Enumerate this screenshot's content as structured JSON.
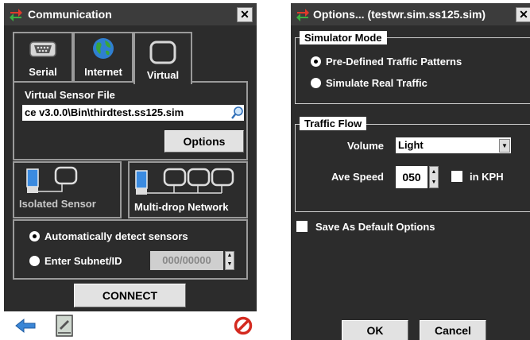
{
  "communication": {
    "title": "Communication",
    "close_label": "✕",
    "tabs": [
      {
        "label": "Serial",
        "icon": "serial-port-icon"
      },
      {
        "label": "Internet",
        "icon": "globe-icon"
      },
      {
        "label": "Virtual",
        "icon": "virtual-device-icon"
      }
    ],
    "selected_tab": "Virtual",
    "virtual_sensor_file_label": "Virtual Sensor File",
    "virtual_sensor_file_value": "ce v3.0.0\\Bin\\thirdtest.ss125.sim",
    "options_button": "Options",
    "topology": {
      "isolated_label": "Isolated Sensor",
      "multidrop_label": "Multi-drop Network",
      "selected": "Multi-drop Network"
    },
    "detect": {
      "auto_label": "Automatically detect sensors",
      "subnet_label": "Enter Subnet/ID",
      "subnet_value": "000/00000",
      "selected": "auto"
    },
    "connect_button": "CONNECT",
    "bottom_icons": [
      "back-arrow-icon",
      "book-icon",
      "no-entry-icon"
    ]
  },
  "options": {
    "title": "Options... (testwr.sim.ss125.sim)",
    "close_label": "✕",
    "simulator_mode": {
      "title": "Simulator Mode",
      "predefined_label": "Pre-Defined Traffic Patterns",
      "real_label": "Simulate Real Traffic",
      "selected": "predefined"
    },
    "traffic_flow": {
      "title": "Traffic Flow",
      "volume_label": "Volume",
      "volume_value": "Light",
      "speed_label": "Ave Speed",
      "speed_value": "050",
      "kph_label": "in KPH",
      "kph_checked": false
    },
    "save_default_label": "Save As Default Options",
    "save_default_checked": false,
    "ok_button": "OK",
    "cancel_button": "Cancel"
  },
  "colors": {
    "window_bg": "#2c2c2c",
    "titlebar_bg": "#3c3c3c",
    "border": "#9a9a9a",
    "button_bg": "#e2e2e2",
    "back_arrow": "#3a86d6",
    "no_entry": "#d42a20"
  }
}
